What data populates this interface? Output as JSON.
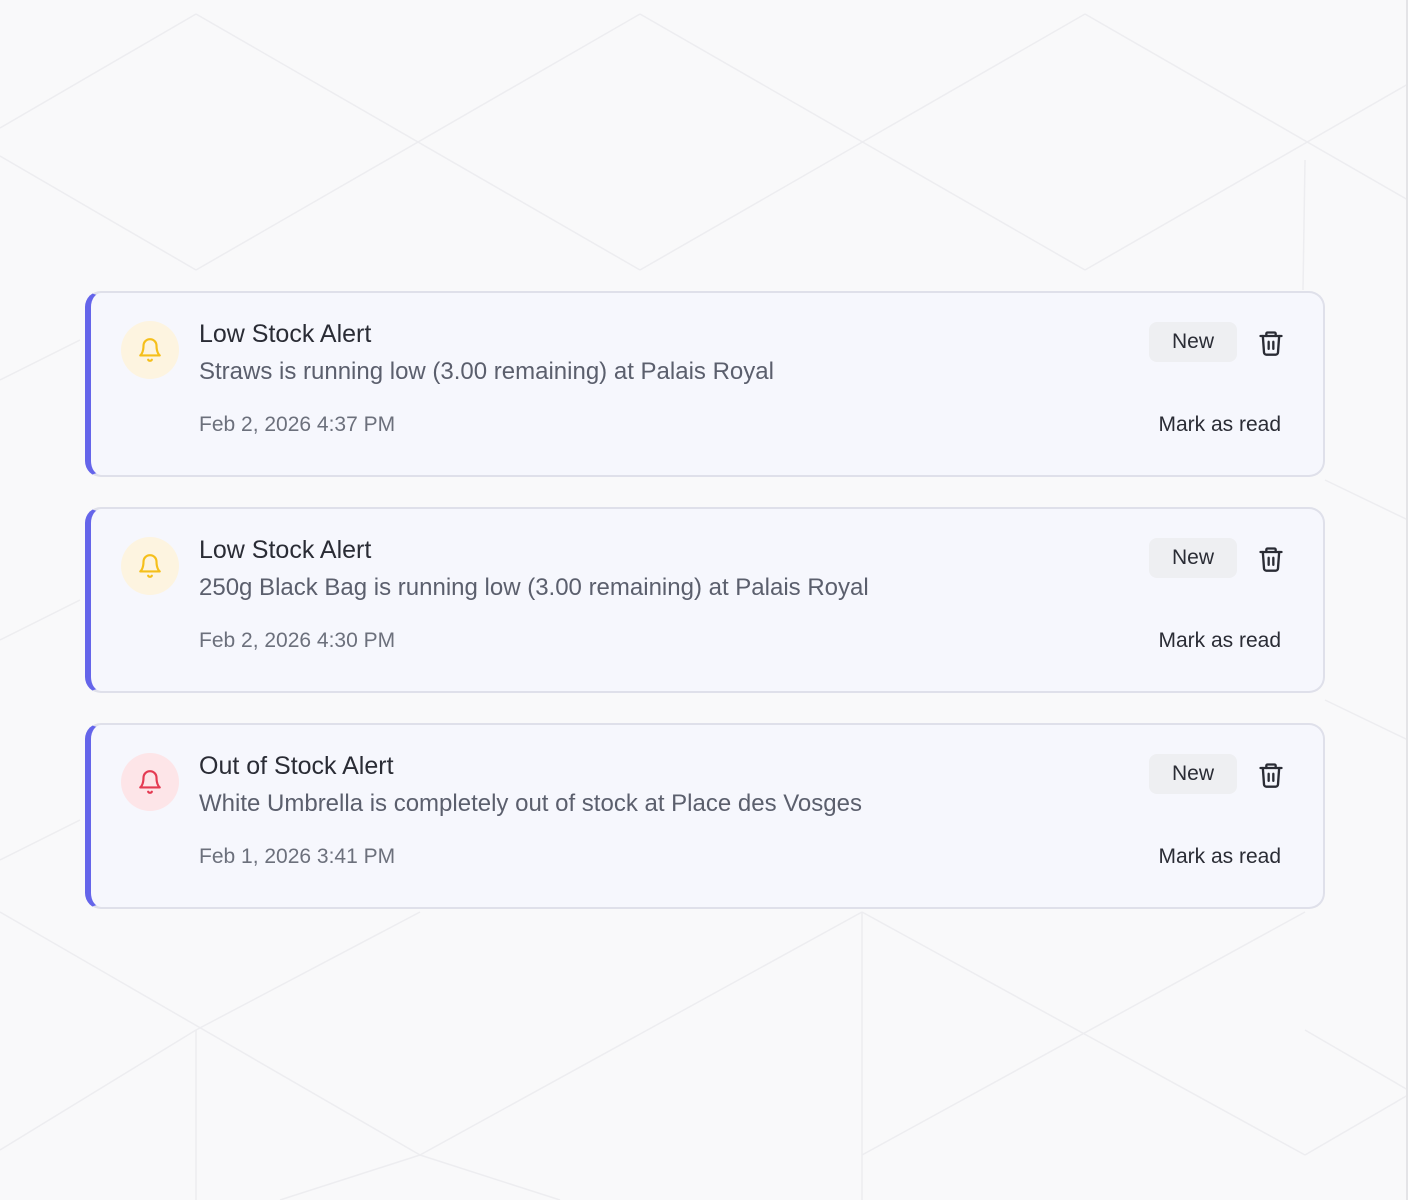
{
  "colors": {
    "accent": "#6565ea",
    "warning": "#f5bf1b",
    "danger": "#e43a52",
    "card_background": "#f6f7fd"
  },
  "notifications": [
    {
      "icon": "bell-icon",
      "severity": "warning",
      "title": "Low Stock Alert",
      "message": "Straws is running low (3.00 remaining) at Palais Royal",
      "timestamp": "Feb 2, 2026 4:37 PM",
      "badge": "New",
      "mark_read_label": "Mark as read",
      "delete_icon": "trash-icon"
    },
    {
      "icon": "bell-icon",
      "severity": "warning",
      "title": "Low Stock Alert",
      "message": "250g Black Bag is running low (3.00 remaining) at Palais Royal",
      "timestamp": "Feb 2, 2026 4:30 PM",
      "badge": "New",
      "mark_read_label": "Mark as read",
      "delete_icon": "trash-icon"
    },
    {
      "icon": "bell-icon",
      "severity": "danger",
      "title": "Out of Stock Alert",
      "message": "White Umbrella is completely out of stock at Place des Vosges",
      "timestamp": "Feb 1, 2026 3:41 PM",
      "badge": "New",
      "mark_read_label": "Mark as read",
      "delete_icon": "trash-icon"
    }
  ]
}
